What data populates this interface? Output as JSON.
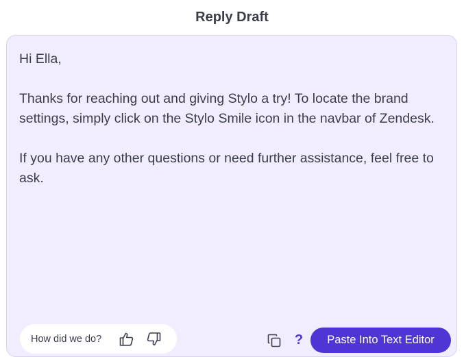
{
  "header": {
    "title": "Reply Draft"
  },
  "draft": {
    "greeting": "Hi Ella,",
    "paragraph_1": "Thanks for reaching out and giving Stylo a try! To locate the brand settings, simply click on the Stylo Smile icon in the navbar of Zendesk.",
    "paragraph_2": "If you have any other questions or need further assistance, feel free to ask."
  },
  "feedback": {
    "label": "How did we do?",
    "thumbs_up_icon": "thumbs-up-icon",
    "thumbs_down_icon": "thumbs-down-icon"
  },
  "actions": {
    "copy_icon": "copy-icon",
    "help_glyph": "?",
    "paste_label": "Paste Into Text Editor"
  },
  "colors": {
    "accent": "#4f35d3",
    "draft_background": "#f1edff",
    "text": "#3a3d4a"
  }
}
